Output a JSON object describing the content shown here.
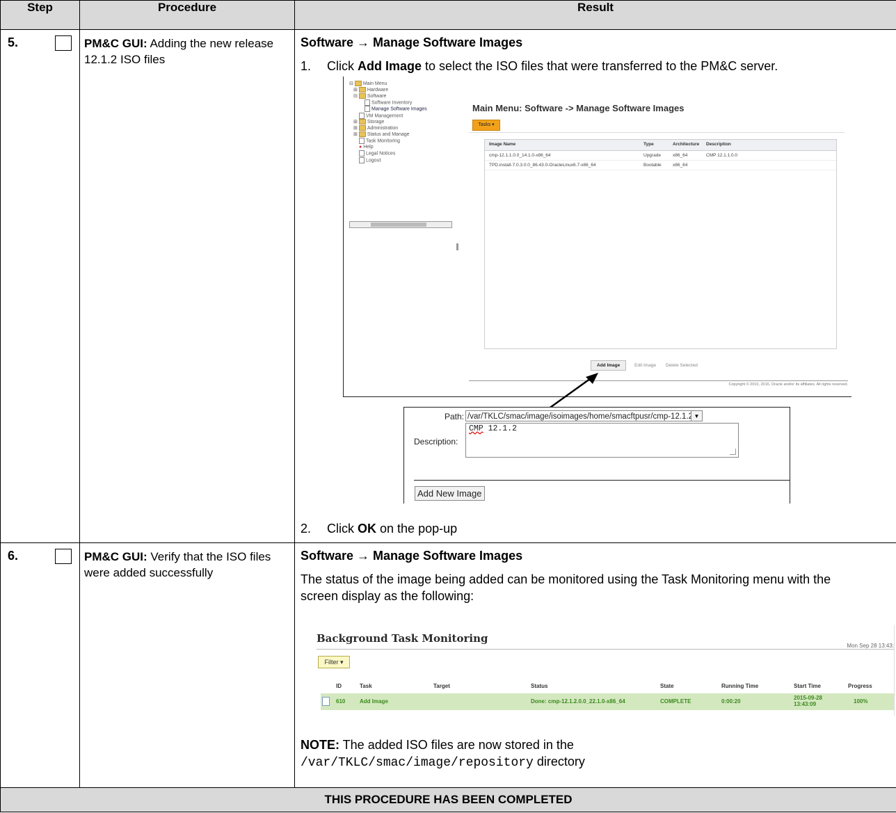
{
  "header": {
    "step": "Step",
    "procedure": "Procedure",
    "result": "Result"
  },
  "steps": [
    {
      "number": "5.",
      "proc_bold": "PM&C GUI:",
      "proc_text": " Adding the new release 12.1.2 ISO files",
      "result_title": "Software → Manage Software Images",
      "line1_prefix": "1.  Click ",
      "line1_bold": "Add Image",
      "line1_suffix": " to select the ISO files that were transferred to the PM&C server.",
      "line2_prefix": "2.  Click ",
      "line2_bold": "OK",
      "line2_suffix": " on the pop-up"
    },
    {
      "number": "6.",
      "proc_bold": "PM&C GUI:",
      "proc_text": " Verify that the ISO files were added successfully",
      "result_title": "Software → Manage Software Images",
      "para": "The status of the image being added can be monitored using the Task Monitoring menu with the screen display as the following:",
      "note_bold": "NOTE:",
      "note_text": " The added ISO files are now stored in the",
      "note_path": "/var/TKLC/smac/image/repository",
      "note_suffix": " directory"
    }
  ],
  "footer": "THIS PROCEDURE HAS BEEN COMPLETED",
  "screenshot1": {
    "title": "Main Menu: Software -> Manage Software Images",
    "tasks_button": "Tasks",
    "tree": [
      "Main Menu",
      "Hardware",
      "Software",
      "Software Inventory",
      "Manage Software Images",
      "VM Management",
      "Storage",
      "Administration",
      "Status and Manage",
      "Task Monitoring",
      "Help",
      "Legal Notices",
      "Logout"
    ],
    "columns": [
      "Image Name",
      "Type",
      "Architecture",
      "Description"
    ],
    "rows": [
      [
        "cmp-12.1.1.0.0_14.1.0-x86_64",
        "Upgrade",
        "x86_64",
        "CMP 12.1.1.0.0"
      ],
      [
        "TPD.install-7.0.3.0.0_86.43.0-OracleLinux6.7-x86_64",
        "Bootable",
        "x86_64",
        ""
      ]
    ],
    "buttons": [
      "Add Image",
      "Edit Image",
      "Delete Selected"
    ],
    "copyright": "Copyright © 2010, 2016, Oracle and/or its affiliates. All rights reserved."
  },
  "dialog": {
    "path_label": "Path:",
    "path_value": "/var/TKLC/smac/image/isoimages/home/smacftpusr/cmp-12.1.2.(",
    "description_label": "Description:",
    "description_word": "CMP",
    "description_rest": " 12.1.2",
    "button": "Add New Image"
  },
  "screenshot2": {
    "title": "Background Task Monitoring",
    "date": "Mon Sep 28 13:43:",
    "filter": "Filter",
    "columns": [
      "ID",
      "Task",
      "Target",
      "Status",
      "State",
      "Running Time",
      "Start Time",
      "Progress"
    ],
    "row": [
      "610",
      "Add Image",
      "",
      "Done: cmp-12.1.2.0.0_22.1.0-x86_64",
      "COMPLETE",
      "0:00:20",
      "2015-09-28 13:43:09",
      "100%"
    ]
  }
}
